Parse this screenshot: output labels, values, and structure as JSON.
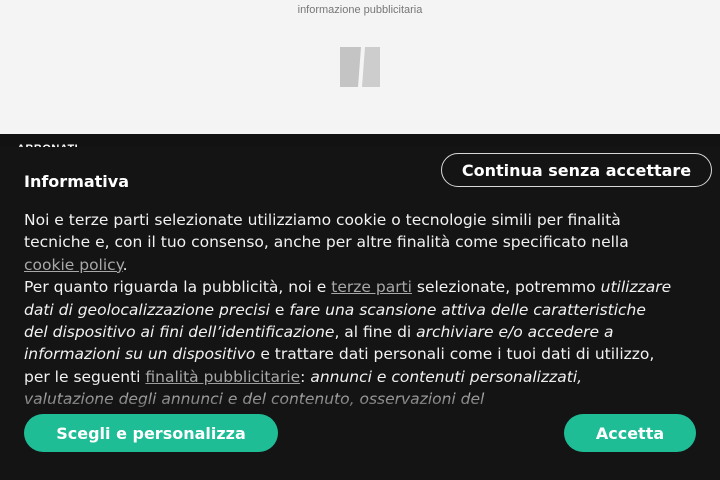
{
  "ad": {
    "label": "informazione pubblicitaria",
    "logo_icon": "slash-logo-icon"
  },
  "nav": {
    "peek_label": "ABBONATI"
  },
  "consent": {
    "continue_label": "Continua senza accettare",
    "title": "Informativa",
    "p1_a": "Noi e terze parti selezionate utilizziamo cookie o tecnologie simili per finalità tecniche e, con il tuo consenso, anche per altre finalità come specificato nella ",
    "p1_link": "cookie policy",
    "p1_b": ".",
    "p2_a": "Per quanto riguarda la pubblicità, noi e ",
    "p2_link1": "terze parti",
    "p2_b": " selezionate, potremmo ",
    "p2_i1": "utilizzare dati di geolocalizzazione precisi",
    "p2_c": " e ",
    "p2_i2": "fare una scansione attiva delle caratteristiche del dispositivo ai fini dell’identificazione",
    "p2_d": ", al fine di ",
    "p2_i3": "archiviare e/o accedere a informazioni su un dispositivo",
    "p2_e": " e trattare dati personali come i tuoi dati di utilizzo, per le seguenti ",
    "p2_link2": "finalità pubblicitarie",
    "p2_f": ": ",
    "p2_i4": "annunci e contenuti personalizzati, valutazione degli annunci e del contenuto, osservazioni del",
    "customize_label": "Scegli e personalizza",
    "accept_label": "Accetta"
  },
  "colors": {
    "accent": "#1ebd96",
    "background_dark": "#141414",
    "link": "#a8a8a8"
  }
}
